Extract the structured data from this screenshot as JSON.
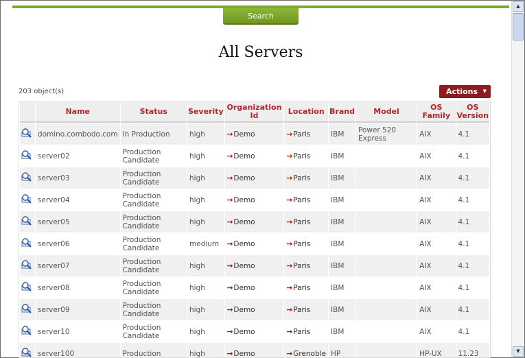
{
  "search": {
    "label": "Search"
  },
  "page": {
    "title": "All Servers",
    "count": "203 object(s)"
  },
  "actions": {
    "label": "Actions",
    "caret": "▼"
  },
  "columns": [
    "Name",
    "Status",
    "Severity",
    "Organization Id",
    "Location",
    "Brand",
    "Model",
    "OS Family",
    "OS Version"
  ],
  "rows": [
    {
      "name": "domino.combodo.com",
      "status": "In Production",
      "severity": "high",
      "org": "Demo",
      "location": "Paris",
      "brand": "IBM",
      "model": "Power 520 Express",
      "os_family": "AIX",
      "os_version": "4.1"
    },
    {
      "name": "server02",
      "status": "Production Candidate",
      "severity": "high",
      "org": "Demo",
      "location": "Paris",
      "brand": "IBM",
      "model": "",
      "os_family": "AIX",
      "os_version": "4.1"
    },
    {
      "name": "server03",
      "status": "Production Candidate",
      "severity": "high",
      "org": "Demo",
      "location": "Paris",
      "brand": "IBM",
      "model": "",
      "os_family": "AIX",
      "os_version": "4.1"
    },
    {
      "name": "server04",
      "status": "Production Candidate",
      "severity": "high",
      "org": "Demo",
      "location": "Paris",
      "brand": "IBM",
      "model": "",
      "os_family": "AIX",
      "os_version": "4.1"
    },
    {
      "name": "server05",
      "status": "Production Candidate",
      "severity": "high",
      "org": "Demo",
      "location": "Paris",
      "brand": "IBM",
      "model": "",
      "os_family": "AIX",
      "os_version": "4.1"
    },
    {
      "name": "server06",
      "status": "Production Candidate",
      "severity": "medium",
      "org": "Demo",
      "location": "Paris",
      "brand": "IBM",
      "model": "",
      "os_family": "AIX",
      "os_version": "4.1"
    },
    {
      "name": "server07",
      "status": "Production Candidate",
      "severity": "high",
      "org": "Demo",
      "location": "Paris",
      "brand": "IBM",
      "model": "",
      "os_family": "AIX",
      "os_version": "4.1"
    },
    {
      "name": "server08",
      "status": "Production Candidate",
      "severity": "high",
      "org": "Demo",
      "location": "Paris",
      "brand": "IBM",
      "model": "",
      "os_family": "AIX",
      "os_version": "4.1"
    },
    {
      "name": "server09",
      "status": "Production Candidate",
      "severity": "high",
      "org": "Demo",
      "location": "Paris",
      "brand": "IBM",
      "model": "",
      "os_family": "AIX",
      "os_version": "4.1"
    },
    {
      "name": "server10",
      "status": "Production Candidate",
      "severity": "high",
      "org": "Demo",
      "location": "Paris",
      "brand": "IBM",
      "model": "",
      "os_family": "AIX",
      "os_version": "4.1"
    },
    {
      "name": "server100",
      "status": "Production",
      "severity": "high",
      "org": "Demo",
      "location": "Grenoble",
      "brand": "HP",
      "model": "",
      "os_family": "HP-UX",
      "os_version": "11.23"
    }
  ],
  "icons": {
    "row_icon": "magnifier-icon",
    "link_arrow": "→"
  },
  "colors": {
    "accent_green": "#80a82a",
    "header_red": "#b0262a",
    "actions_bg": "#8e1b1f"
  }
}
